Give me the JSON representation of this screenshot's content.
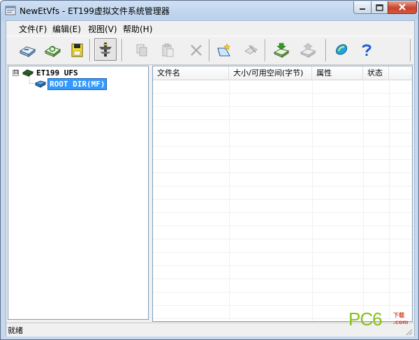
{
  "window": {
    "title": "NewEtVfs - ET199虚拟文件系统管理器"
  },
  "menu": [
    "文件(F)",
    "编辑(E)",
    "视图(V)",
    "帮助(H)"
  ],
  "toolbar": {
    "buttons": [
      {
        "icon": "open-disk-icon",
        "enabled": true
      },
      {
        "icon": "refresh-disk-icon",
        "enabled": true
      },
      {
        "icon": "format-disk-icon",
        "enabled": true
      },
      {
        "icon": "connect-tool-icon",
        "enabled": true,
        "pressed": true
      },
      {
        "icon": "copy-icon",
        "enabled": false
      },
      {
        "icon": "paste-icon",
        "enabled": false
      },
      {
        "icon": "delete-icon",
        "enabled": false
      },
      {
        "icon": "new-folder-icon",
        "enabled": true
      },
      {
        "icon": "properties-icon",
        "enabled": false
      },
      {
        "icon": "import-icon",
        "enabled": true
      },
      {
        "icon": "export-icon",
        "enabled": false
      },
      {
        "icon": "about-icon",
        "enabled": true
      },
      {
        "icon": "help-icon",
        "enabled": true
      }
    ]
  },
  "tree": {
    "root": {
      "label": "ET199 UFS",
      "expander": "⊟"
    },
    "child": {
      "label": "ROOT DIR(MF)",
      "selected": true
    }
  },
  "list": {
    "columns": [
      "文件名",
      "大小/可用空间(字节)",
      "属性",
      "状态"
    ]
  },
  "status": {
    "text": "就绪"
  },
  "watermark": {
    "main": "PC6",
    "side_top": "下载",
    "side_bottom": ".com"
  },
  "colors": {
    "selection": "#3399ff",
    "accent_green": "#8bbf1c",
    "watermark_red": "#d04a2e"
  }
}
